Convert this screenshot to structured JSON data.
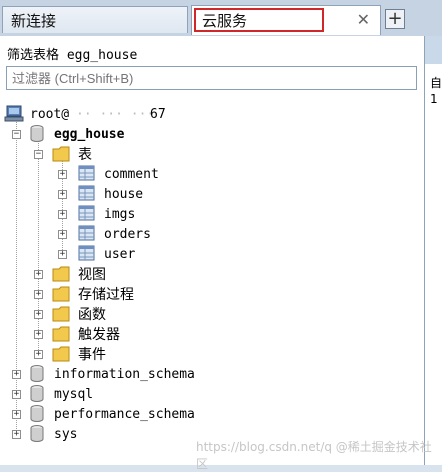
{
  "tabs": [
    {
      "label": "新连接"
    },
    {
      "label": "云服务"
    }
  ],
  "filter": {
    "label": "筛选表格 egg_house",
    "placeholder": "过滤器 (Ctrl+Shift+B)"
  },
  "tree": {
    "connection": "root@",
    "connection_tail": "67",
    "db_main": "egg_house",
    "tables_folder": "表",
    "tables": [
      "comment",
      "house",
      "imgs",
      "orders",
      "user"
    ],
    "folders": [
      "视图",
      "存储过程",
      "函数",
      "触发器",
      "事件"
    ],
    "other_dbs": [
      "information_schema",
      "mysql",
      "performance_schema",
      "sys"
    ]
  },
  "right_panel": {
    "line1": "自",
    "line2": "1"
  },
  "watermark": "https://blog.csdn.net/q  @稀土掘金技术社区",
  "icons": {
    "close": "close-icon",
    "plus": "plus-icon",
    "server": "server-icon",
    "database": "database-icon",
    "folder": "folder-icon",
    "table": "table-icon"
  }
}
